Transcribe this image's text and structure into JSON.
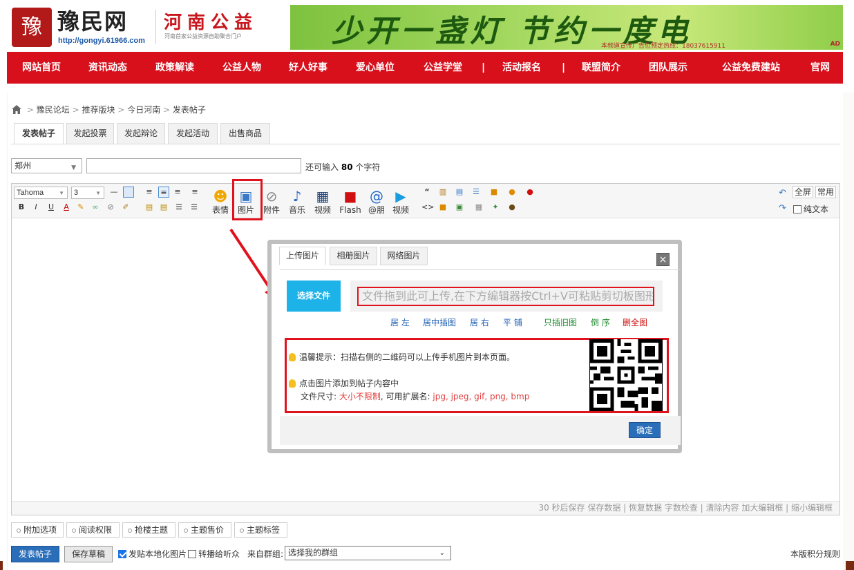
{
  "header": {
    "logo_seal": "豫民",
    "logo_name": "豫民网",
    "logo_url": "http://gongyi.61966.com",
    "logo_sub": "河南公益",
    "logo_desc": "河南首家公益资源自助聚合门户",
    "banner_text": "少开一盏灯  节约一度电",
    "banner_small": "本频道宣传广告位预定热线：18037615911",
    "banner_ad": "AD"
  },
  "nav": [
    "网站首页",
    "资讯动态",
    "政策解读",
    "公益人物",
    "好人好事",
    "爱心单位",
    "公益学堂",
    "|",
    "活动报名",
    "|",
    "联盟简介",
    "团队展示",
    "公益免费建站",
    "官网"
  ],
  "breadcrumb": {
    "items": [
      "豫民论坛",
      "推荐版块",
      "今日河南",
      "发表帖子"
    ],
    "sep": ">"
  },
  "tabs": [
    "发表帖子",
    "发起投票",
    "发起辩论",
    "发起活动",
    "出售商品"
  ],
  "form": {
    "city": "郑州",
    "remain_prefix": "还可输入",
    "remain_count": "80",
    "remain_suffix": "个字符"
  },
  "toolbar": {
    "font": "Tahoma",
    "size": "3",
    "big_buttons": [
      "表情",
      "图片",
      "附件",
      "音乐",
      "视频",
      "Flash",
      "@朋",
      "视频"
    ],
    "right": {
      "fullscreen": "全屏",
      "common": "常用",
      "plain_text": "纯文本"
    }
  },
  "status_bar": "30 秒后保存 保存数据 | 恢复数据    字数检查 | 清除内容    加大编辑框 | 缩小编辑框",
  "dialog": {
    "tabs": [
      "上传图片",
      "相册图片",
      "网络图片"
    ],
    "close": "×",
    "choose_file": "选择文件",
    "drop_hint": "文件拖到此可上传,在下方编辑器按Ctrl+V可粘贴剪切板图形",
    "options": [
      {
        "label": "居 左",
        "color": "#1e5fb4"
      },
      {
        "label": "居中插图",
        "color": "#1e5fb4"
      },
      {
        "label": "居 右",
        "color": "#1e5fb4"
      },
      {
        "label": "平 铺",
        "color": "#1e5fb4"
      },
      {
        "label": "只插旧图",
        "color": "#1a8a2a"
      },
      {
        "label": "倒 序",
        "color": "#1a8a2a"
      },
      {
        "label": "删全图",
        "color": "#d01010"
      }
    ],
    "tip1": "温馨提示：扫描右侧的二维码可以上传手机图片到本页面。",
    "tip2": "点击图片添加到帖子内容中",
    "tip3_prefix": "文件尺寸: ",
    "tip3_size": "大小不限制",
    "tip3_mid": ", 可用扩展名: ",
    "tip3_ext": "jpg, jpeg, gif, png, bmp",
    "ok": "确定"
  },
  "extras": [
    "附加选项",
    "阅读权限",
    "抢楼主题",
    "主题售价",
    "主题标签"
  ],
  "bottom": {
    "post": "发表帖子",
    "draft": "保存草稿",
    "local_images": "发贴本地化图片",
    "forward": "转播给听众",
    "group_label": "来自群组:",
    "group_select": "选择我的群组",
    "rules": "本版积分规则"
  },
  "colors": {
    "nav_red": "#d7101c",
    "accent_red": "#e0121d",
    "button_blue": "#2a6db8",
    "choose_blue": "#1eb3e8"
  }
}
